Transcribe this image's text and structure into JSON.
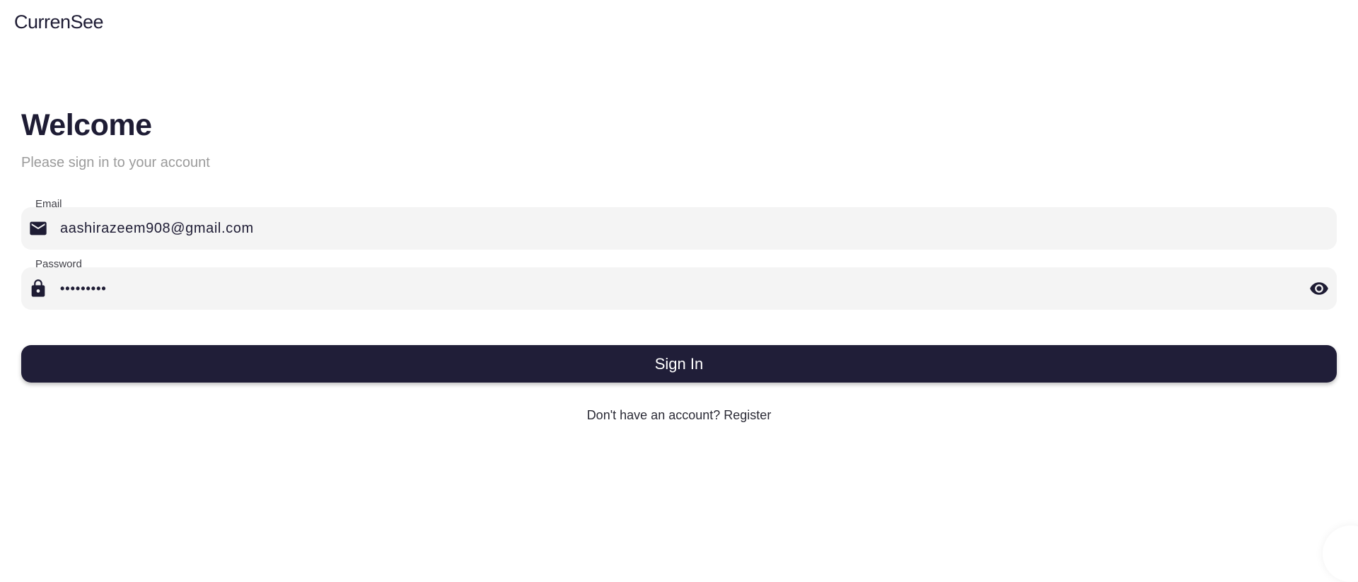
{
  "app": {
    "title": "CurrenSee"
  },
  "login": {
    "heading": "Welcome",
    "subtitle": "Please sign in to your account",
    "email": {
      "label": "Email",
      "value": "aashirazeem908@gmail.com",
      "icon": "mail-icon"
    },
    "password": {
      "label": "Password",
      "masked_value": "•••••••••",
      "icon": "lock-icon",
      "toggle_icon": "eye-icon"
    },
    "signin_label": "Sign In",
    "register_prompt": "Don't have an account?",
    "register_label": "Register"
  },
  "colors": {
    "primary": "#201e38",
    "field_bg": "#f4f4f4",
    "subtitle": "#9b9b9b"
  }
}
